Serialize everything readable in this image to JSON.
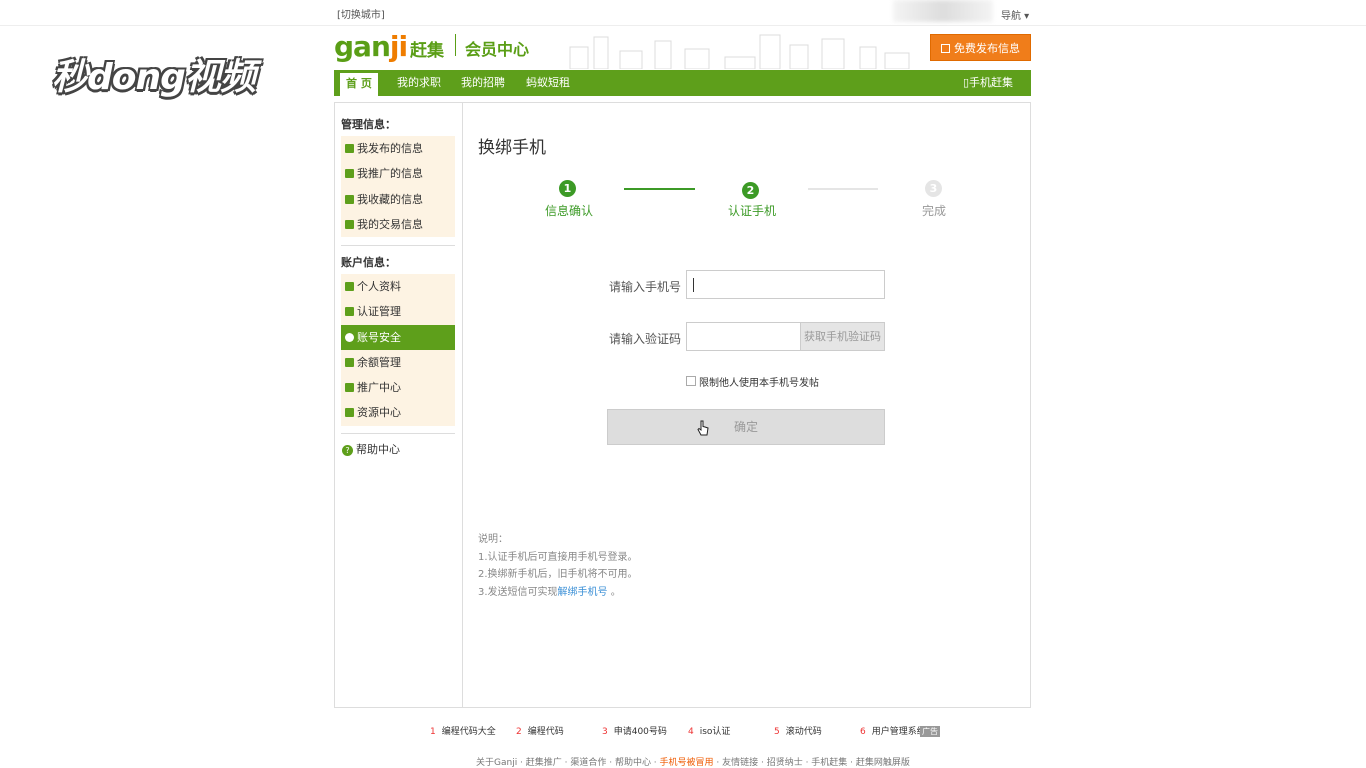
{
  "topbar": {
    "city_switch": "[切换城市]",
    "nav": "导航 ▾"
  },
  "watermark": "秒dong视频",
  "header": {
    "logo_gan": "gan",
    "logo_ji": "ji",
    "logo_cn": "赶集",
    "member_center": "会员中心",
    "post_button": "免费发布信息"
  },
  "nav": {
    "tabs": [
      "首 页",
      "我的求职",
      "我的招聘",
      "蚂蚁短租"
    ],
    "mobile": "▯手机赶集"
  },
  "sidebar": {
    "manage_title": "管理信息：",
    "manage_items": [
      "我发布的信息",
      "我推广的信息",
      "我收藏的信息",
      "我的交易信息"
    ],
    "account_title": "账户信息：",
    "account_items": [
      "个人资料",
      "认证管理",
      "账号安全",
      "余额管理",
      "推广中心",
      "资源中心"
    ],
    "help": "帮助中心"
  },
  "main": {
    "title": "换绑手机",
    "steps": [
      {
        "num": "1",
        "label": "信息确认"
      },
      {
        "num": "2",
        "label": "认证手机"
      },
      {
        "num": "3",
        "label": "完成"
      }
    ],
    "phone_label": "请输入手机号",
    "phone_value": "",
    "code_label": "请输入验证码",
    "code_value": "",
    "get_code_button": "获取手机验证码",
    "restrict_checkbox": "限制他人使用本手机号发帖",
    "confirm_button": "确定",
    "notes_title": "说明：",
    "note1": "1.认证手机后可直接用手机号登录。",
    "note2": "2.换绑新手机后，旧手机将不可用。",
    "note3_pre": "3.发送短信可实现",
    "note3_link": "解绑手机号",
    "note3_post": " 。"
  },
  "footer": {
    "ads": [
      {
        "n": "1",
        "t": "编程代码大全"
      },
      {
        "n": "2",
        "t": "编程代码"
      },
      {
        "n": "3",
        "t": "申请400号码"
      },
      {
        "n": "4",
        "t": "iso认证"
      },
      {
        "n": "5",
        "t": "滚动代码"
      },
      {
        "n": "6",
        "t": "用户管理系统"
      }
    ],
    "ad_tag": "广告",
    "links_pre": "关于Ganji · 赶集推广 · 渠道合作 · 帮助中心 · ",
    "links_hl": "手机号被冒用",
    "links_post": " · 友情链接 · 招贤纳士 · 手机赶集 · 赶集网触屏版"
  },
  "colors": {
    "brand_green": "#5e9f1b",
    "step_green": "#3c9a26",
    "orange": "#f07d1a",
    "link_blue": "#3a8fd6"
  }
}
